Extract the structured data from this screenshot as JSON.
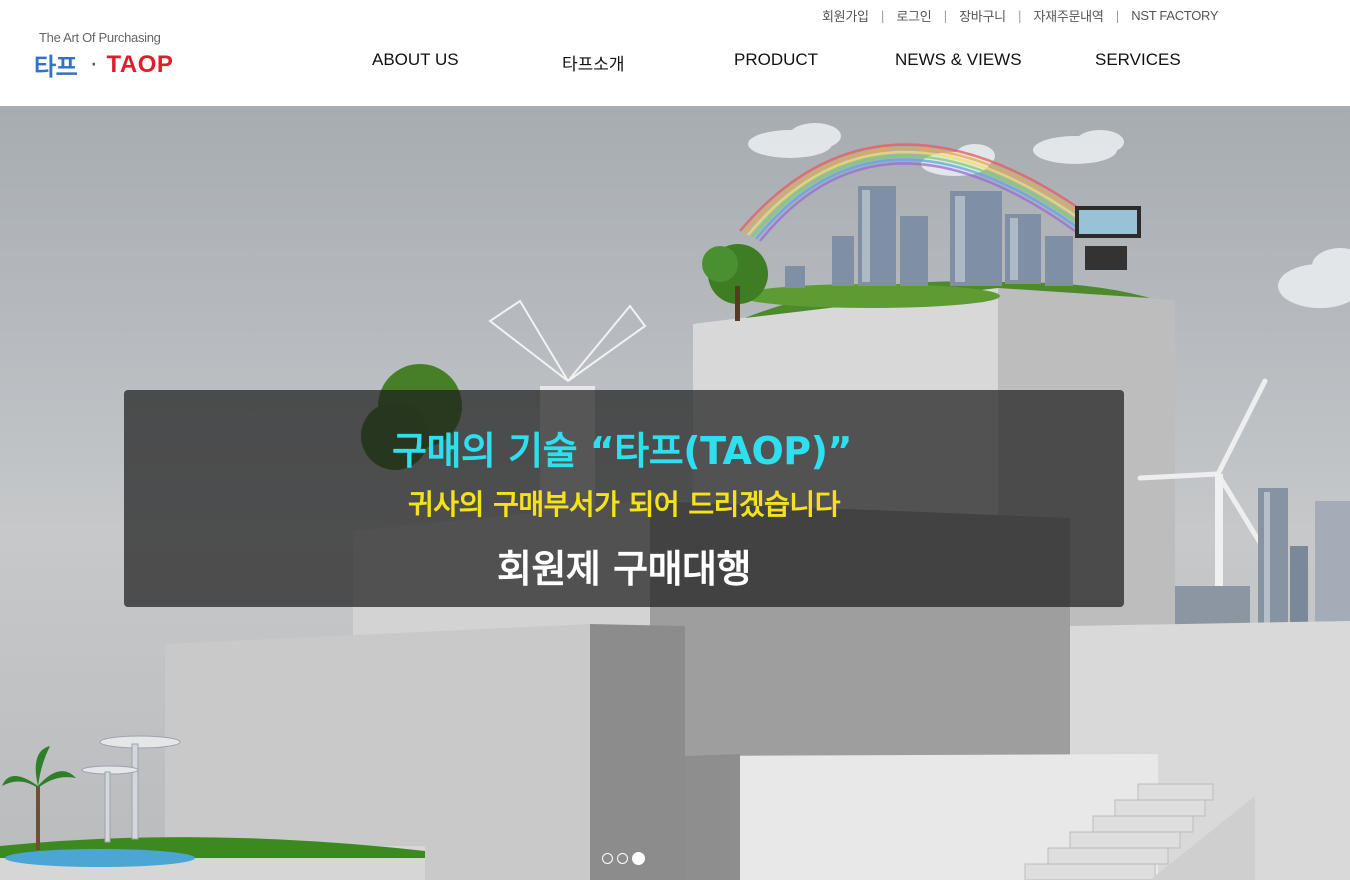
{
  "util_nav": {
    "signup": "회원가입",
    "login": "로그인",
    "cart": "장바구니",
    "orders": "자재주문내역",
    "nst": "NST FACTORY",
    "separator": "|"
  },
  "logo": {
    "tagline": "The Art Of Purchasing",
    "korean": "타프",
    "dot": "·",
    "english": "TAOP"
  },
  "main_nav": {
    "items": [
      {
        "label": "ABOUT US"
      },
      {
        "label": "타프소개"
      },
      {
        "label": "PRODUCT"
      },
      {
        "label": "NEWS & VIEWS"
      },
      {
        "label": "SERVICES"
      }
    ]
  },
  "hero": {
    "headline": "구매의 기술 “타프(TAOP)”",
    "subline": "귀사의 구매부서가 되어 드리겠습니다",
    "tagline": "회원제 구매대행",
    "slides_total": 3,
    "active_slide": 3
  },
  "colors": {
    "logo_blue": "#2f72c8",
    "logo_red": "#e01e2a",
    "headline_cyan": "#2ee0ef",
    "subline_yellow": "#f5e21b"
  }
}
